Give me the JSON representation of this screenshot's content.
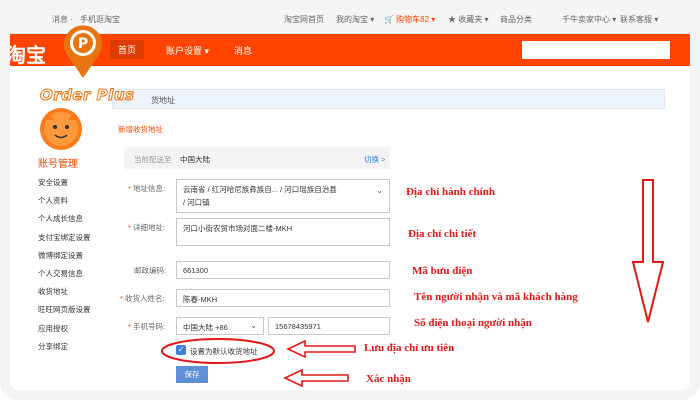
{
  "topbar": {
    "items": [
      "消息 ·",
      "手机逛淘宝",
      "淘宝网首页",
      "我的淘宝 ▾",
      "🛒 购物车82 ▾",
      "★ 收藏夹 ▾",
      "商品分类",
      "千牛卖家中心 ▾",
      "联系客服 ▾"
    ]
  },
  "nav": {
    "brand": "淘宝",
    "items": [
      "首页",
      "账户设置 ▾",
      "消息"
    ]
  },
  "logo": {
    "text": "Order Plus"
  },
  "breadcrumb": "货地址",
  "sidebar": {
    "title": "账号管理",
    "items": [
      "安全设置",
      "个人资料",
      "个人成长信息",
      "支付宝绑定设置",
      "微博绑定设置",
      "个人交易信息",
      "收货地址",
      "旺旺网页版设置",
      "应用授权",
      "分享绑定"
    ]
  },
  "form": {
    "new_title": "新增收货地址",
    "region_label": "当前配送至",
    "region_value": "中国大陆",
    "region_switch": "切换 >",
    "address_label": "地址信息:",
    "address_line1": "云南省 / 红河哈尼族彝族自... / 河口瑶族自治县",
    "address_line2": "/ 河口镇",
    "detail_label": "详细地址:",
    "detail_value": "河口小街农贸市场对面二楼-MKH",
    "zip_label": "邮政编码:",
    "zip_value": "661300",
    "name_label": "收货人姓名:",
    "name_value": "陈春-MKH",
    "phone_label": "手机号码:",
    "phone_country": "中国大陆 +86",
    "phone_value": "15678435971",
    "default_label": "设置为默认收货地址",
    "save_label": "保存",
    "star": "*"
  },
  "annotations": {
    "admin_address": "Địa chỉ hành chính",
    "detail_address": "Địa chỉ chi tiết",
    "zip_code": "Mã bưu điện",
    "recipient": "Tên người nhận và mã khách hàng",
    "phone": "Số điện thoại người nhận",
    "save_priority": "Lưu địa chỉ ưu tiên",
    "confirm": "Xác nhận"
  },
  "colors": {
    "taobao_orange": "#ff4400",
    "annotation_red": "#e01818",
    "button_blue": "#5f8fd8"
  },
  "icons": [
    "location-pin-icon",
    "chevron-down-icon",
    "checkbox-checked-icon",
    "down-arrow-icon",
    "left-arrow-icon"
  ]
}
